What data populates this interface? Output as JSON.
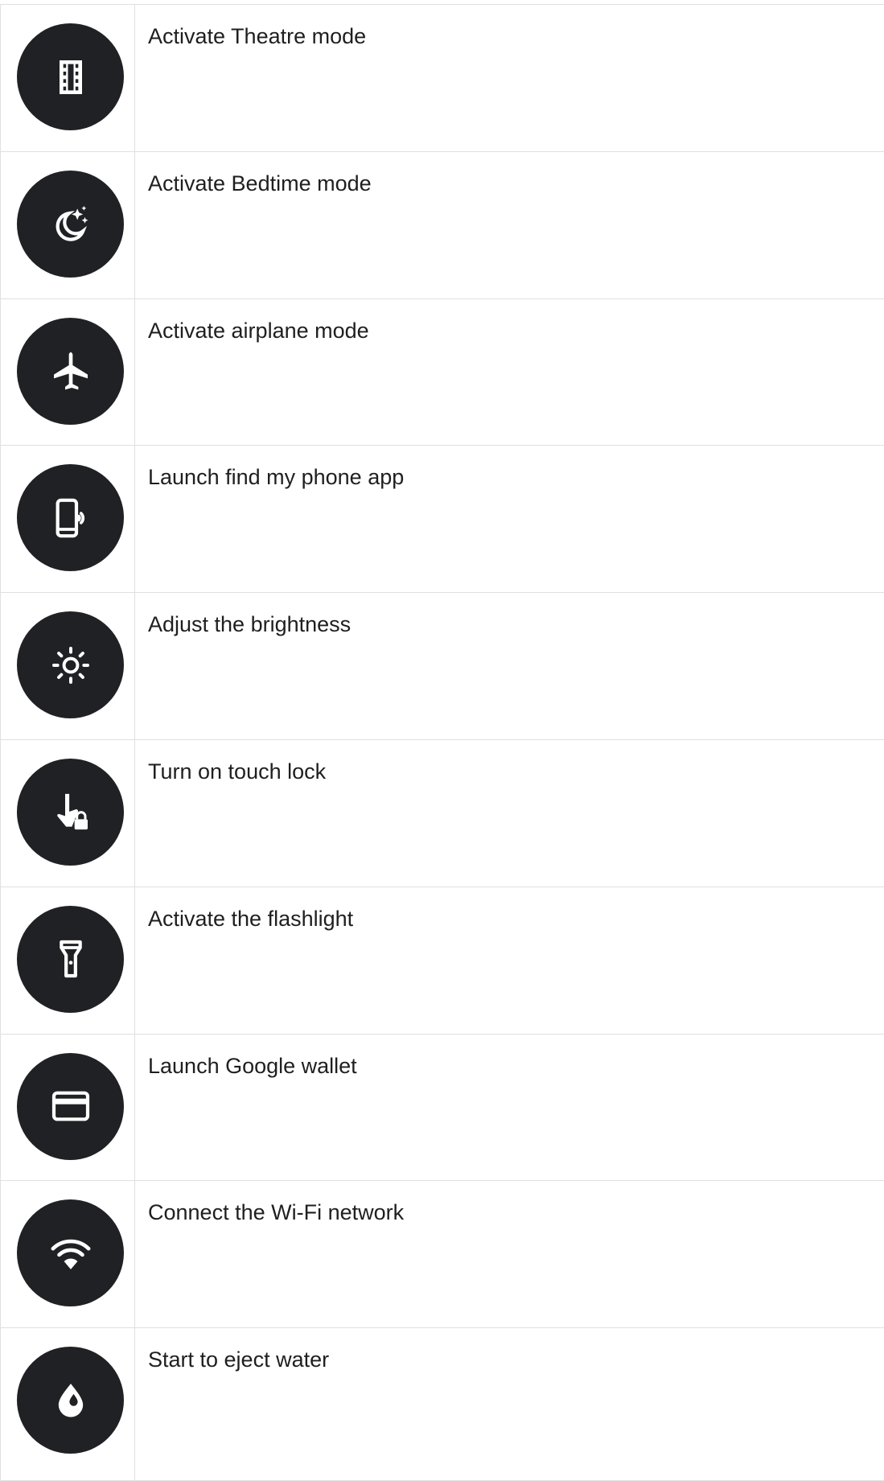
{
  "rows": [
    {
      "icon": "theatre-mode-icon",
      "label": "Activate Theatre mode"
    },
    {
      "icon": "bedtime-mode-icon",
      "label": "Activate Bedtime mode"
    },
    {
      "icon": "airplane-icon",
      "label": "Activate airplane mode"
    },
    {
      "icon": "find-my-phone-icon",
      "label": "Launch find my phone app"
    },
    {
      "icon": "brightness-icon",
      "label": "Adjust the brightness"
    },
    {
      "icon": "touch-lock-icon",
      "label": "Turn on touch lock"
    },
    {
      "icon": "flashlight-icon",
      "label": "Activate the flashlight"
    },
    {
      "icon": "wallet-card-icon",
      "label": "Launch Google wallet"
    },
    {
      "icon": "wifi-icon",
      "label": "Connect the Wi-Fi network"
    },
    {
      "icon": "water-drop-icon",
      "label": "Start to eject water"
    }
  ],
  "colors": {
    "tile_background": "#202124",
    "icon_foreground": "#ffffff",
    "grid_line": "#e0e0e0",
    "text": "#1f1f1f"
  }
}
